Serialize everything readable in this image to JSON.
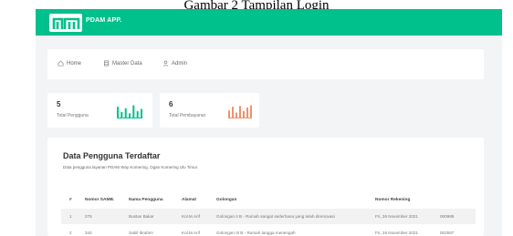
{
  "caption": "Gambar 2 Tampilan Login",
  "header": {
    "app_name": "PDAM APP."
  },
  "nav": [
    {
      "label": "Home",
      "icon": "home-icon"
    },
    {
      "label": "Master Data",
      "icon": "database-icon"
    },
    {
      "label": "Admin",
      "icon": "user-icon"
    }
  ],
  "stats": [
    {
      "value": "5",
      "label": "Total Pengguna",
      "color": "#00c08b",
      "bars": [
        0.8,
        0.45,
        0.7,
        0.35,
        0.9,
        0.5,
        0.65
      ]
    },
    {
      "value": "6",
      "label": "Total Pembayaran",
      "color": "#f0906c",
      "bars": [
        0.55,
        0.8,
        0.4,
        0.85,
        0.5,
        0.75,
        0.9
      ]
    }
  ],
  "table": {
    "title": "Data Pengguna Terdaftar",
    "subtitle": "Data pengguna layanan PDAM Way Komering, Ogan Komering Ulu Timur.",
    "headers": [
      "#",
      "Nomor SAMB.",
      "Nama Pengguna",
      "Alamat",
      "Golongan",
      "Nomor Rekening"
    ],
    "rows": [
      [
        "1",
        "275",
        "Bustan Bakar",
        "Kol.M.Arif",
        "Golongan II B - Rumah sangat sederhana yang telah direnovasi",
        "Fri, 26 November 2021",
        "000989"
      ],
      [
        "2",
        "340",
        "Sabil Ibrahim",
        "Kol.M.Arif",
        "Golongan III B - Rumah tangga menengah",
        "Fri, 26 November 2021",
        "002587"
      ]
    ]
  },
  "colors": {
    "brand": "#00c08b",
    "accent": "#f0906c"
  }
}
